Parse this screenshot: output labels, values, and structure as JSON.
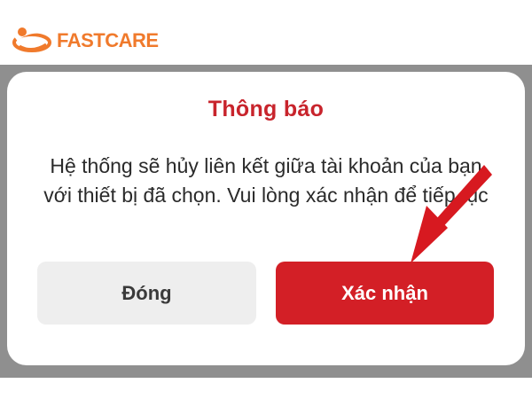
{
  "brand": {
    "name": "FASTCARE",
    "color": "#f07a2c",
    "icon": "fastcare-swoosh-logo"
  },
  "dialog": {
    "title": "Thông báo",
    "message": "Hệ thống sẽ hủy liên kết giữa tài khoản của bạn với thiết bị đã chọn. Vui lòng xác nhận để tiếp tục",
    "buttons": {
      "close_label": "Đóng",
      "confirm_label": "Xác nhận"
    }
  },
  "colors": {
    "title": "#c8242c",
    "confirm_button": "#d31f26",
    "close_button": "#eeeeee",
    "overlay": "#8f8f8f",
    "annotation_arrow": "#d71920"
  },
  "annotation": {
    "icon": "red-pointer-arrow-icon"
  }
}
